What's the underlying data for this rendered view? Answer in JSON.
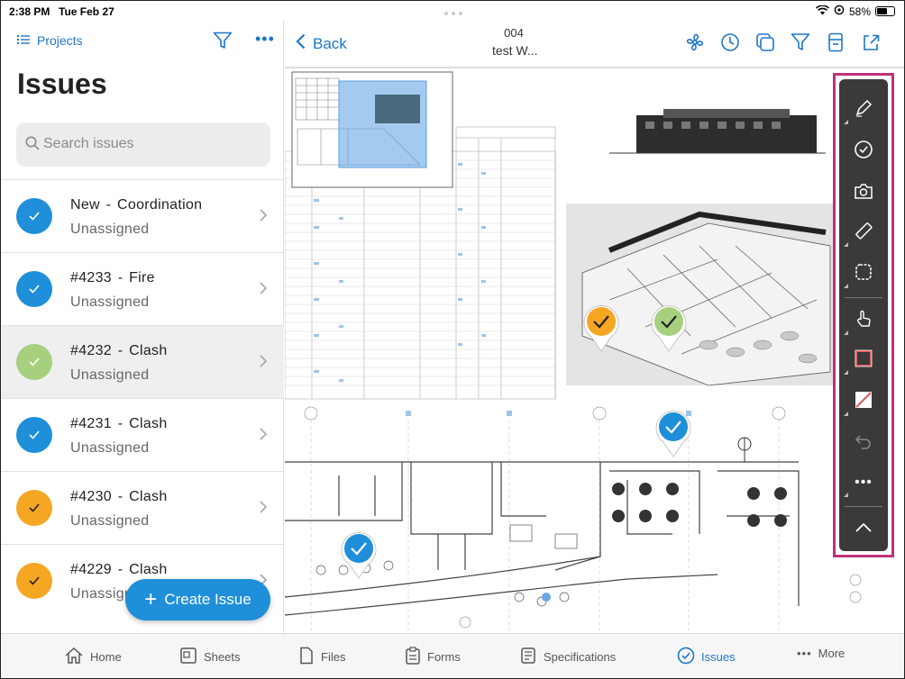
{
  "status_bar": {
    "time": "2:38 PM",
    "date": "Tue Feb 27",
    "battery": "58%"
  },
  "left_panel": {
    "projects_label": "Projects",
    "title": "Issues",
    "search_placeholder": "Search issues",
    "issues": [
      {
        "title": "New  -  Coordination",
        "assignee": "Unassigned",
        "status_color": "#1e8fd8",
        "selected": false
      },
      {
        "title": "#4233  -  Fire",
        "assignee": "Unassigned",
        "status_color": "#1e8fd8",
        "selected": false
      },
      {
        "title": "#4232  -  Clash",
        "assignee": "Unassigned",
        "status_color": "#a6cf7e",
        "selected": true
      },
      {
        "title": "#4231  -  Clash",
        "assignee": "Unassigned",
        "status_color": "#1e8fd8",
        "selected": false
      },
      {
        "title": "#4230  -  Clash",
        "assignee": "Unassigned",
        "status_color": "#f5a623",
        "selected": false
      },
      {
        "title": "#4229  -  Clash",
        "assignee": "Unassigned",
        "status_color": "#f5a623",
        "selected": false
      }
    ],
    "create_button": "Create Issue"
  },
  "viewer": {
    "back_label": "Back",
    "sheet_number": "004",
    "sheet_name": "test W...",
    "toolbar_icons": [
      "pen-icon",
      "checkmark-circle-icon",
      "camera-icon",
      "ruler-icon",
      "cloud-shape-icon",
      "hand-pointer-icon",
      "rectangle-icon",
      "line-icon",
      "undo-icon",
      "more-icon",
      "collapse-chevron-icon"
    ]
  },
  "tab_bar": {
    "tabs": [
      {
        "label": "Home",
        "icon": "home-icon",
        "active": false
      },
      {
        "label": "Sheets",
        "icon": "sheets-icon",
        "active": false
      },
      {
        "label": "Files",
        "icon": "file-icon",
        "active": false
      },
      {
        "label": "Forms",
        "icon": "clipboard-icon",
        "active": false
      },
      {
        "label": "Specifications",
        "icon": "spec-icon",
        "active": false
      },
      {
        "label": "Issues",
        "icon": "check-circle-icon",
        "active": true
      },
      {
        "label": "More",
        "icon": "ellipsis-icon",
        "active": false
      }
    ]
  },
  "colors": {
    "accent": "#1e76c9",
    "toolbar_highlight": "#c0307a",
    "blue_status": "#1e8fd8",
    "green_status": "#a6cf7e",
    "orange_status": "#f5a623"
  }
}
